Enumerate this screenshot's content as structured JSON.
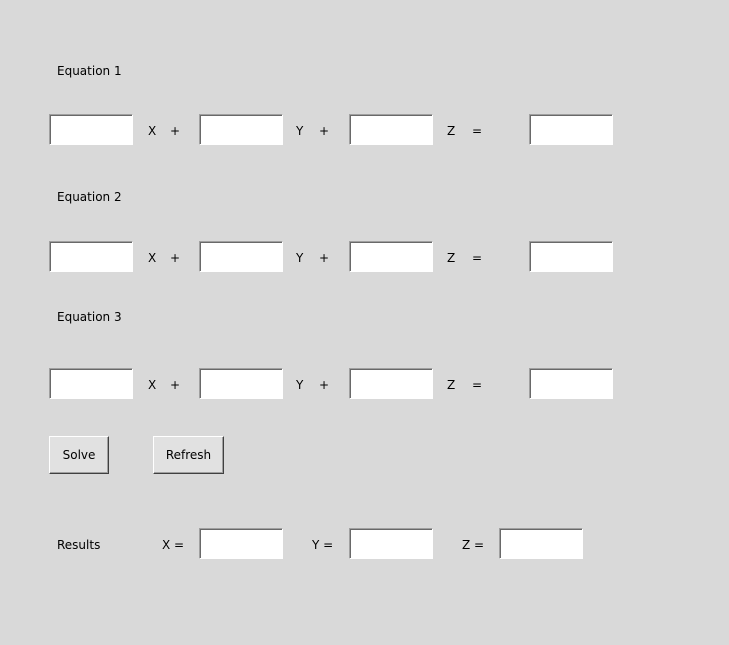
{
  "equations": [
    {
      "title": "Equation 1",
      "x_label": "X",
      "plus1": "+",
      "y_label": "Y",
      "plus2": "+",
      "z_label": "Z",
      "equals": "=",
      "values": [
        "",
        "",
        "",
        ""
      ]
    },
    {
      "title": "Equation 2",
      "x_label": "X",
      "plus1": "+",
      "y_label": "Y",
      "plus2": "+",
      "z_label": "Z",
      "equals": "=",
      "values": [
        "",
        "",
        "",
        ""
      ]
    },
    {
      "title": "Equation 3",
      "x_label": "X",
      "plus1": "+",
      "y_label": "Y",
      "plus2": "+",
      "z_label": "Z",
      "equals": "=",
      "values": [
        "",
        "",
        "",
        ""
      ]
    }
  ],
  "buttons": {
    "solve": "Solve",
    "refresh": "Refresh"
  },
  "results": {
    "label": "Results",
    "x_label": "X  =",
    "y_label": "Y  =",
    "z_label": "Z  =",
    "x": "",
    "y": "",
    "z": ""
  }
}
